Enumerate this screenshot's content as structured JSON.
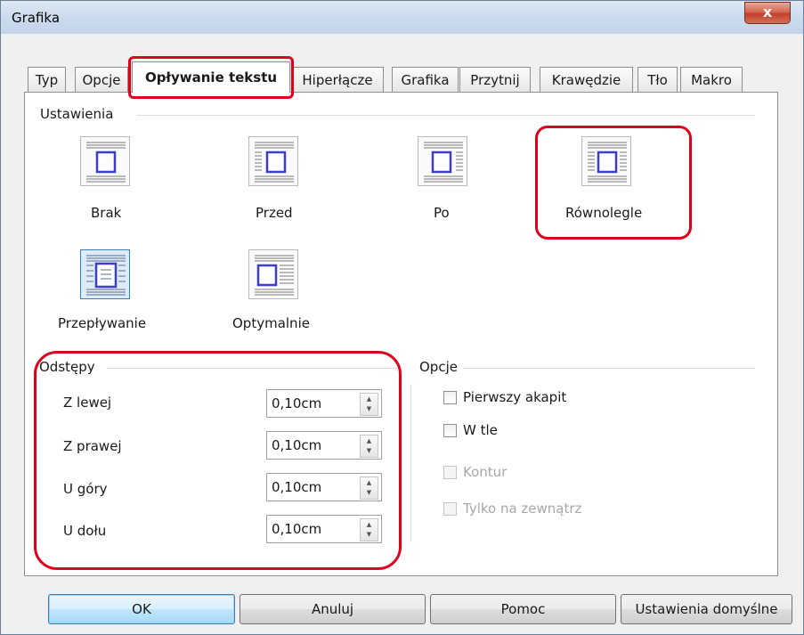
{
  "window": {
    "title": "Grafika",
    "close_symbol": "x"
  },
  "tabs": [
    "Typ",
    "Opcje",
    "Opływanie tekstu",
    "Hiperłącze",
    "Grafika",
    "Przytnij",
    "Krawędzie",
    "Tło",
    "Makro"
  ],
  "settings": {
    "label": "Ustawienia",
    "items": [
      {
        "label": "Brak",
        "icon": "wrap-none-icon"
      },
      {
        "label": "Przed",
        "icon": "wrap-before-icon"
      },
      {
        "label": "Po",
        "icon": "wrap-after-icon"
      },
      {
        "label": "Równolegle",
        "icon": "wrap-parallel-icon"
      },
      {
        "label": "Przepływanie",
        "icon": "wrap-through-icon"
      },
      {
        "label": "Optymalnie",
        "icon": "wrap-optimal-icon"
      }
    ]
  },
  "spacing": {
    "label": "Odstępy",
    "rows": [
      {
        "label": "Z lewej",
        "value": "0,10cm"
      },
      {
        "label": "Z prawej",
        "value": "0,10cm"
      },
      {
        "label": "U góry",
        "value": "0,10cm"
      },
      {
        "label": "U dołu",
        "value": "0,10cm"
      }
    ]
  },
  "options": {
    "label": "Opcje",
    "checkboxes": [
      {
        "label": "Pierwszy akapit",
        "checked": false,
        "enabled": true
      },
      {
        "label": "W tle",
        "checked": false,
        "enabled": true
      },
      {
        "label": "Kontur",
        "checked": false,
        "enabled": false
      },
      {
        "label": "Tylko na zewnątrz",
        "checked": false,
        "enabled": false
      }
    ]
  },
  "buttons": {
    "ok": "OK",
    "cancel": "Anuluj",
    "help": "Pomoc",
    "defaults": "Ustawienia domyślne"
  },
  "colors": {
    "highlight": "#e0001b",
    "selected_icon": "#3c7fb1",
    "icon_blue": "#3d3dc9"
  }
}
